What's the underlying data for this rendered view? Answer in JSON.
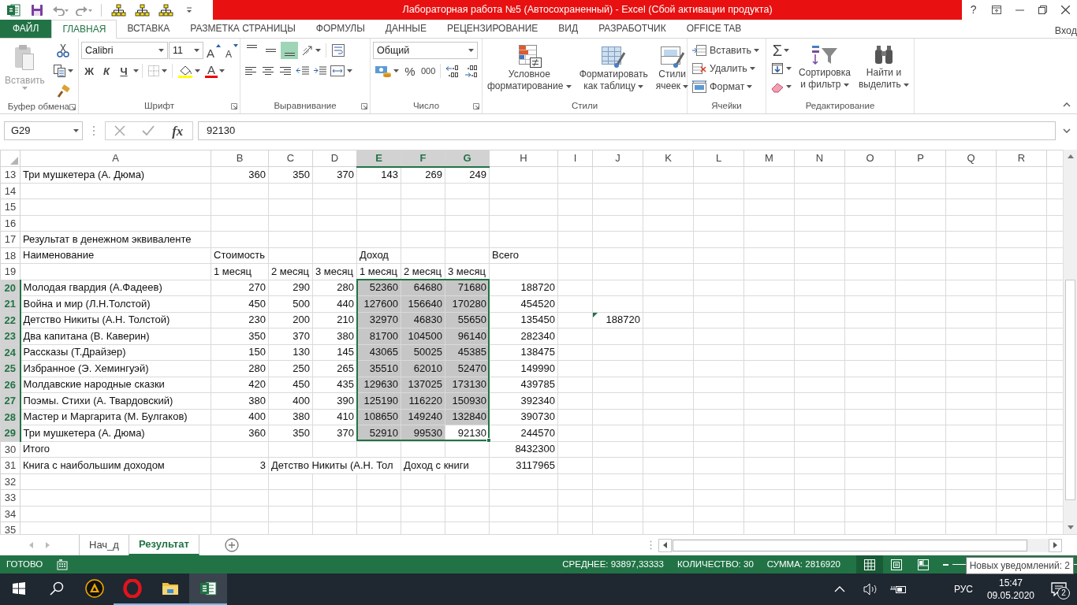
{
  "window": {
    "title": "Лабораторная работа №5 (Автосохраненный) -  Excel (Сбой активации продукта)",
    "help": "?"
  },
  "ribbon_tabs": [
    {
      "label": "ФАЙЛ",
      "kind": "file",
      "selected": false
    },
    {
      "label": "ГЛАВНАЯ",
      "kind": "tab",
      "selected": true
    },
    {
      "label": "ВСТАВКА",
      "kind": "tab",
      "selected": false
    },
    {
      "label": "РАЗМЕТКА СТРАНИЦЫ",
      "kind": "tab",
      "selected": false
    },
    {
      "label": "ФОРМУЛЫ",
      "kind": "tab",
      "selected": false
    },
    {
      "label": "ДАННЫЕ",
      "kind": "tab",
      "selected": false
    },
    {
      "label": "РЕЦЕНЗИРОВАНИЕ",
      "kind": "tab",
      "selected": false
    },
    {
      "label": "ВИД",
      "kind": "tab",
      "selected": false
    },
    {
      "label": "РАЗРАБОТЧИК",
      "kind": "tab",
      "selected": false
    },
    {
      "label": "OFFICE TAB",
      "kind": "tab",
      "selected": false
    }
  ],
  "account": "Вход",
  "ribbon_groups": [
    {
      "kind": "clipboard",
      "label": "Буфер обмена",
      "paste": {
        "label": "Вставить",
        "disabled": true
      }
    },
    {
      "kind": "font",
      "label": "Шрифт",
      "font_name": "Calibri",
      "font_size": "11",
      "grow": "A",
      "shrink": "A",
      "bold": "Ж",
      "italic": "К",
      "underline": "Ч",
      "font_color": "A"
    },
    {
      "kind": "alignment",
      "label": "Выравнивание",
      "vertical": [
        {
          "selected": false
        },
        {
          "selected": false
        },
        {
          "selected": true
        }
      ],
      "horizontal": [
        {
          "selected": false
        },
        {
          "selected": false
        },
        {
          "selected": false
        }
      ]
    },
    {
      "kind": "number",
      "label": "Число",
      "format": "Общий",
      "percent": "%",
      "thousands": "000"
    },
    {
      "kind": "styles",
      "label": "Стили",
      "buttons": [
        {
          "lines": [
            "Условное",
            "форматирование"
          ]
        },
        {
          "lines": [
            "Форматировать",
            "как таблицу"
          ]
        },
        {
          "lines": [
            "Стили",
            "ячеек"
          ]
        }
      ]
    },
    {
      "kind": "cells",
      "label": "Ячейки",
      "buttons": [
        "Вставить",
        "Удалить",
        "Формат"
      ]
    },
    {
      "kind": "editing",
      "label": "Редактирование",
      "autosum": "Σ",
      "buttons": [
        {
          "lines": [
            "Сортировка",
            "и фильтр"
          ]
        },
        {
          "lines": [
            "Найти и",
            "выделить"
          ]
        }
      ]
    }
  ],
  "formula_bar": {
    "name_box": "G29",
    "fx": "fx",
    "value": "92130"
  },
  "columns": [
    {
      "label": "A",
      "selected": false
    },
    {
      "label": "B",
      "selected": false
    },
    {
      "label": "C",
      "selected": false
    },
    {
      "label": "D",
      "selected": false
    },
    {
      "label": "E",
      "selected": true
    },
    {
      "label": "F",
      "selected": true
    },
    {
      "label": "G",
      "selected": true
    },
    {
      "label": "H",
      "selected": false
    },
    {
      "label": "I",
      "selected": false
    },
    {
      "label": "J",
      "selected": false
    },
    {
      "label": "K",
      "selected": false
    },
    {
      "label": "L",
      "selected": false
    },
    {
      "label": "M",
      "selected": false
    },
    {
      "label": "N",
      "selected": false
    },
    {
      "label": "O",
      "selected": false
    },
    {
      "label": "P",
      "selected": false
    },
    {
      "label": "Q",
      "selected": false
    },
    {
      "label": "R",
      "selected": false
    }
  ],
  "rows": [
    {
      "number": "13",
      "selected": false,
      "cells": {
        "A": {
          "kind": "text",
          "text": "Три мушкетера (А. Дюма)"
        },
        "B": {
          "kind": "number",
          "text": "360"
        },
        "C": {
          "kind": "number",
          "text": "350"
        },
        "D": {
          "kind": "number",
          "text": "370"
        },
        "E": {
          "kind": "number",
          "text": "143"
        },
        "F": {
          "kind": "number",
          "text": "269"
        },
        "G": {
          "kind": "number",
          "text": "249"
        }
      }
    },
    {
      "number": "14",
      "selected": false,
      "cells": {}
    },
    {
      "number": "15",
      "selected": false,
      "cells": {}
    },
    {
      "number": "16",
      "selected": false,
      "cells": {}
    },
    {
      "number": "17",
      "selected": false,
      "cells": {
        "A": {
          "kind": "text",
          "text": "Результат в денежном эквиваленте"
        }
      }
    },
    {
      "number": "18",
      "selected": false,
      "cells": {
        "A": {
          "kind": "text",
          "text": "Наименование"
        },
        "B": {
          "kind": "text",
          "text": "Стоимость"
        },
        "E": {
          "kind": "text",
          "text": "Доход"
        },
        "H": {
          "kind": "text",
          "text": "Всего"
        }
      }
    },
    {
      "number": "19",
      "selected": false,
      "cells": {
        "B": {
          "kind": "text",
          "text": "1 месяц"
        },
        "C": {
          "kind": "text",
          "text": "2 месяц"
        },
        "D": {
          "kind": "text",
          "text": "3 месяц"
        },
        "E": {
          "kind": "text",
          "text": "1 месяц"
        },
        "F": {
          "kind": "text",
          "text": "2 месяц"
        },
        "G": {
          "kind": "text",
          "text": "3 месяц"
        }
      }
    },
    {
      "number": "20",
      "selected": true,
      "cells": {
        "A": {
          "kind": "text",
          "text": "Молодая гвардия (А.Фадеев)"
        },
        "B": {
          "kind": "number",
          "text": "270"
        },
        "C": {
          "kind": "number",
          "text": "290"
        },
        "D": {
          "kind": "number",
          "text": "280"
        },
        "E": {
          "kind": "number",
          "text": "52360"
        },
        "F": {
          "kind": "number",
          "text": "64680"
        },
        "G": {
          "kind": "number",
          "text": "71680"
        },
        "H": {
          "kind": "number",
          "text": "188720"
        }
      }
    },
    {
      "number": "21",
      "selected": true,
      "cells": {
        "A": {
          "kind": "text",
          "text": "Война и мир (Л.Н.Толстой)"
        },
        "B": {
          "kind": "number",
          "text": "450"
        },
        "C": {
          "kind": "number",
          "text": "500"
        },
        "D": {
          "kind": "number",
          "text": "440"
        },
        "E": {
          "kind": "number",
          "text": "127600"
        },
        "F": {
          "kind": "number",
          "text": "156640"
        },
        "G": {
          "kind": "number",
          "text": "170280"
        },
        "H": {
          "kind": "number",
          "text": "454520"
        }
      }
    },
    {
      "number": "22",
      "selected": true,
      "cells": {
        "A": {
          "kind": "text",
          "text": "Детство Никиты (А.Н. Толстой)"
        },
        "B": {
          "kind": "number",
          "text": "230"
        },
        "C": {
          "kind": "number",
          "text": "200"
        },
        "D": {
          "kind": "number",
          "text": "210"
        },
        "E": {
          "kind": "number",
          "text": "32970"
        },
        "F": {
          "kind": "number",
          "text": "46830"
        },
        "G": {
          "kind": "number",
          "text": "55650"
        },
        "H": {
          "kind": "number",
          "text": "135450"
        },
        "J": {
          "kind": "number",
          "text": "188720",
          "flagged": true
        }
      }
    },
    {
      "number": "23",
      "selected": true,
      "cells": {
        "A": {
          "kind": "text",
          "text": "Два капитана (В. Каверин)"
        },
        "B": {
          "kind": "number",
          "text": "350"
        },
        "C": {
          "kind": "number",
          "text": "370"
        },
        "D": {
          "kind": "number",
          "text": "380"
        },
        "E": {
          "kind": "number",
          "text": "81700"
        },
        "F": {
          "kind": "number",
          "text": "104500"
        },
        "G": {
          "kind": "number",
          "text": "96140"
        },
        "H": {
          "kind": "number",
          "text": "282340"
        }
      }
    },
    {
      "number": "24",
      "selected": true,
      "cells": {
        "A": {
          "kind": "text",
          "text": "Рассказы (Т.Драйзер)"
        },
        "B": {
          "kind": "number",
          "text": "150"
        },
        "C": {
          "kind": "number",
          "text": "130"
        },
        "D": {
          "kind": "number",
          "text": "145"
        },
        "E": {
          "kind": "number",
          "text": "43065"
        },
        "F": {
          "kind": "number",
          "text": "50025"
        },
        "G": {
          "kind": "number",
          "text": "45385"
        },
        "H": {
          "kind": "number",
          "text": "138475"
        }
      }
    },
    {
      "number": "25",
      "selected": true,
      "cells": {
        "A": {
          "kind": "text",
          "text": "Избранное (Э. Хемингуэй)"
        },
        "B": {
          "kind": "number",
          "text": "280"
        },
        "C": {
          "kind": "number",
          "text": "250"
        },
        "D": {
          "kind": "number",
          "text": "265"
        },
        "E": {
          "kind": "number",
          "text": "35510"
        },
        "F": {
          "kind": "number",
          "text": "62010"
        },
        "G": {
          "kind": "number",
          "text": "52470"
        },
        "H": {
          "kind": "number",
          "text": "149990"
        }
      }
    },
    {
      "number": "26",
      "selected": true,
      "cells": {
        "A": {
          "kind": "text",
          "text": "Молдавские народные сказки"
        },
        "B": {
          "kind": "number",
          "text": "420"
        },
        "C": {
          "kind": "number",
          "text": "450"
        },
        "D": {
          "kind": "number",
          "text": "435"
        },
        "E": {
          "kind": "number",
          "text": "129630"
        },
        "F": {
          "kind": "number",
          "text": "137025"
        },
        "G": {
          "kind": "number",
          "text": "173130"
        },
        "H": {
          "kind": "number",
          "text": "439785"
        }
      }
    },
    {
      "number": "27",
      "selected": true,
      "cells": {
        "A": {
          "kind": "text",
          "text": "Поэмы. Стихи (А. Твардовский)"
        },
        "B": {
          "kind": "number",
          "text": "380"
        },
        "C": {
          "kind": "number",
          "text": "400"
        },
        "D": {
          "kind": "number",
          "text": "390"
        },
        "E": {
          "kind": "number",
          "text": "125190"
        },
        "F": {
          "kind": "number",
          "text": "116220"
        },
        "G": {
          "kind": "number",
          "text": "150930"
        },
        "H": {
          "kind": "number",
          "text": "392340"
        }
      }
    },
    {
      "number": "28",
      "selected": true,
      "cells": {
        "A": {
          "kind": "text",
          "text": "Мастер и Маргарита (М. Булгаков)"
        },
        "B": {
          "kind": "number",
          "text": "400"
        },
        "C": {
          "kind": "number",
          "text": "380"
        },
        "D": {
          "kind": "number",
          "text": "410"
        },
        "E": {
          "kind": "number",
          "text": "108650"
        },
        "F": {
          "kind": "number",
          "text": "149240"
        },
        "G": {
          "kind": "number",
          "text": "132840"
        },
        "H": {
          "kind": "number",
          "text": "390730"
        }
      }
    },
    {
      "number": "29",
      "selected": true,
      "cells": {
        "A": {
          "kind": "text",
          "text": "Три мушкетера (А. Дюма)"
        },
        "B": {
          "kind": "number",
          "text": "360"
        },
        "C": {
          "kind": "number",
          "text": "350"
        },
        "D": {
          "kind": "number",
          "text": "370"
        },
        "E": {
          "kind": "number",
          "text": "52910"
        },
        "F": {
          "kind": "number",
          "text": "99530"
        },
        "G": {
          "kind": "number",
          "text": "92130",
          "active": true
        },
        "H": {
          "kind": "number",
          "text": "244570"
        }
      }
    },
    {
      "number": "30",
      "selected": false,
      "cells": {
        "A": {
          "kind": "text",
          "text": "Итого"
        },
        "H": {
          "kind": "number",
          "text": "8432300"
        }
      }
    },
    {
      "number": "31",
      "selected": false,
      "cells": {
        "A": {
          "kind": "text",
          "text": "Книга с наибольшим доходом"
        },
        "B": {
          "kind": "number",
          "text": "3"
        },
        "C": {
          "kind": "text",
          "text": "Детство Никиты (А.Н. Тол"
        },
        "F": {
          "kind": "text",
          "text": "Доход с книги"
        },
        "H": {
          "kind": "number",
          "text": "3117965"
        }
      }
    },
    {
      "number": "32",
      "selected": false,
      "cells": {}
    },
    {
      "number": "33",
      "selected": false,
      "cells": {}
    },
    {
      "number": "34",
      "selected": false,
      "cells": {}
    },
    {
      "number": "35",
      "selected": false,
      "cells": {}
    }
  ],
  "sheet_tabs": [
    {
      "label": "Нач_д",
      "selected": false
    },
    {
      "label": "Результат",
      "selected": true
    }
  ],
  "status_bar": {
    "mode": "ГОТОВО",
    "average": "СРЕДНЕЕ: 93897,33333",
    "count": "КОЛИЧЕСТВО: 30",
    "sum": "СУММА: 2816920",
    "views": [
      {
        "kind": "normal",
        "selected": true
      },
      {
        "kind": "page_layout",
        "selected": false
      },
      {
        "kind": "page_break",
        "selected": false
      }
    ]
  },
  "tooltip": "Новых уведомлений: 2",
  "taskbar": {
    "apps": [
      {
        "kind": "triangle",
        "running": false,
        "selected": false
      },
      {
        "kind": "browser",
        "running": true,
        "selected": false
      },
      {
        "kind": "folder",
        "running": true,
        "selected": false
      },
      {
        "kind": "spreadsheet",
        "running": true,
        "selected": true
      }
    ],
    "language": "РУС",
    "time": "15:47",
    "date": "09.05.2020",
    "notifications": "2"
  }
}
